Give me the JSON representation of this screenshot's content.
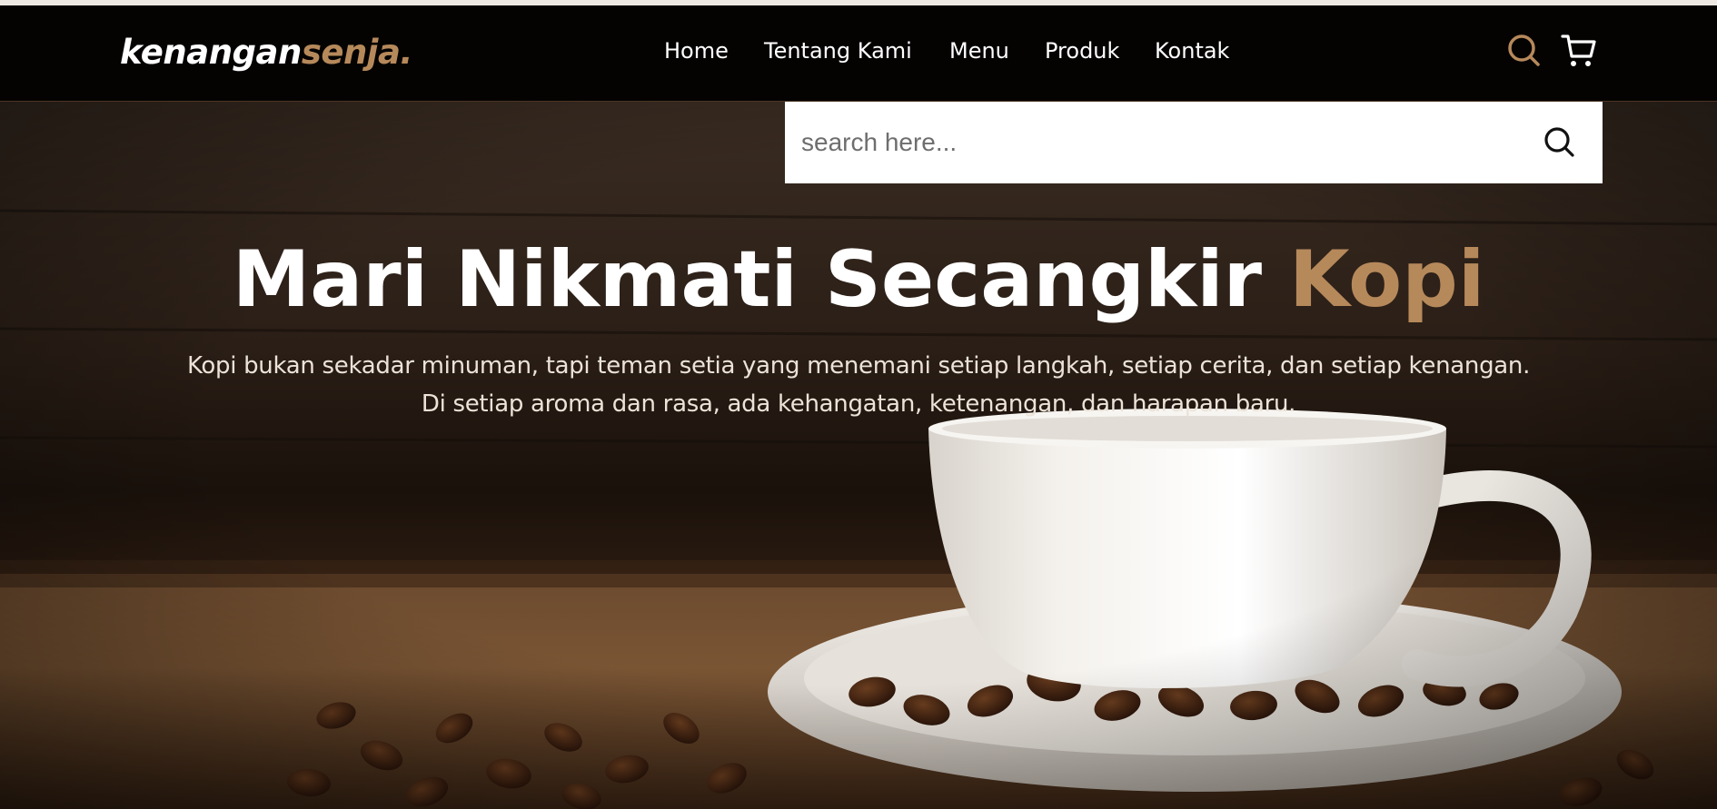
{
  "brand": {
    "name_part1": "kenangan",
    "name_part2": "senja."
  },
  "nav": {
    "links": [
      {
        "label": "Home"
      },
      {
        "label": "Tentang Kami"
      },
      {
        "label": "Menu"
      },
      {
        "label": "Produk"
      },
      {
        "label": "Kontak"
      }
    ],
    "icons": [
      "search-icon",
      "cart-icon"
    ]
  },
  "search": {
    "placeholder": "search here...",
    "value": ""
  },
  "hero": {
    "title_main": "Mari Nikmati Secangkir ",
    "title_accent": "Kopi",
    "subtitle_line1": "Kopi bukan sekadar minuman, tapi teman setia yang menemani setiap langkah, setiap cerita, dan setiap kenangan.",
    "subtitle_line2": "Di setiap aroma dan rasa, ada kehangatan, ketenangan, dan harapan baru."
  },
  "colors": {
    "accent": "#b6895b",
    "navbar_bg": "#050302",
    "text": "#ffffff"
  }
}
